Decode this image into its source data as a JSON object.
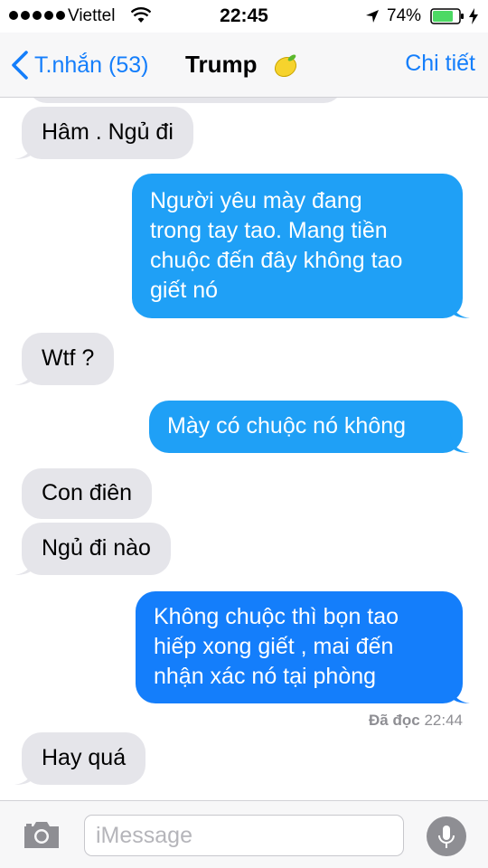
{
  "status_bar": {
    "carrier": "Viettel",
    "time": "22:45",
    "battery": "74%"
  },
  "nav": {
    "back_label": "T.nhắn (53)",
    "contact": "Trump",
    "details": "Chi tiết"
  },
  "messages": [
    {
      "from": "them",
      "text": "Hâm . Ngủ đi"
    },
    {
      "from": "me",
      "text": "Người yêu mày đang\ntrong tay tao. Mang tiền\nchuộc đến đây không tao\ngiết nó"
    },
    {
      "from": "them",
      "text": "Wtf ?"
    },
    {
      "from": "me",
      "text": "Mày có chuộc nó không"
    },
    {
      "from": "them",
      "text": "Con điên"
    },
    {
      "from": "them",
      "text": "Ngủ đi nào"
    },
    {
      "from": "me",
      "text": "Không chuộc thì bọn tao\nhiếp xong giết , mai đến\nnhận xác nó tại phòng"
    },
    {
      "from": "them",
      "text": "Hay quá"
    }
  ],
  "read_receipt": {
    "label": "Đã đọc",
    "time": "22:44"
  },
  "input": {
    "placeholder": "iMessage"
  },
  "colors": {
    "accent": "#147efb",
    "bubble_out": "#1fa0f6",
    "bubble_in": "#e5e5ea"
  }
}
